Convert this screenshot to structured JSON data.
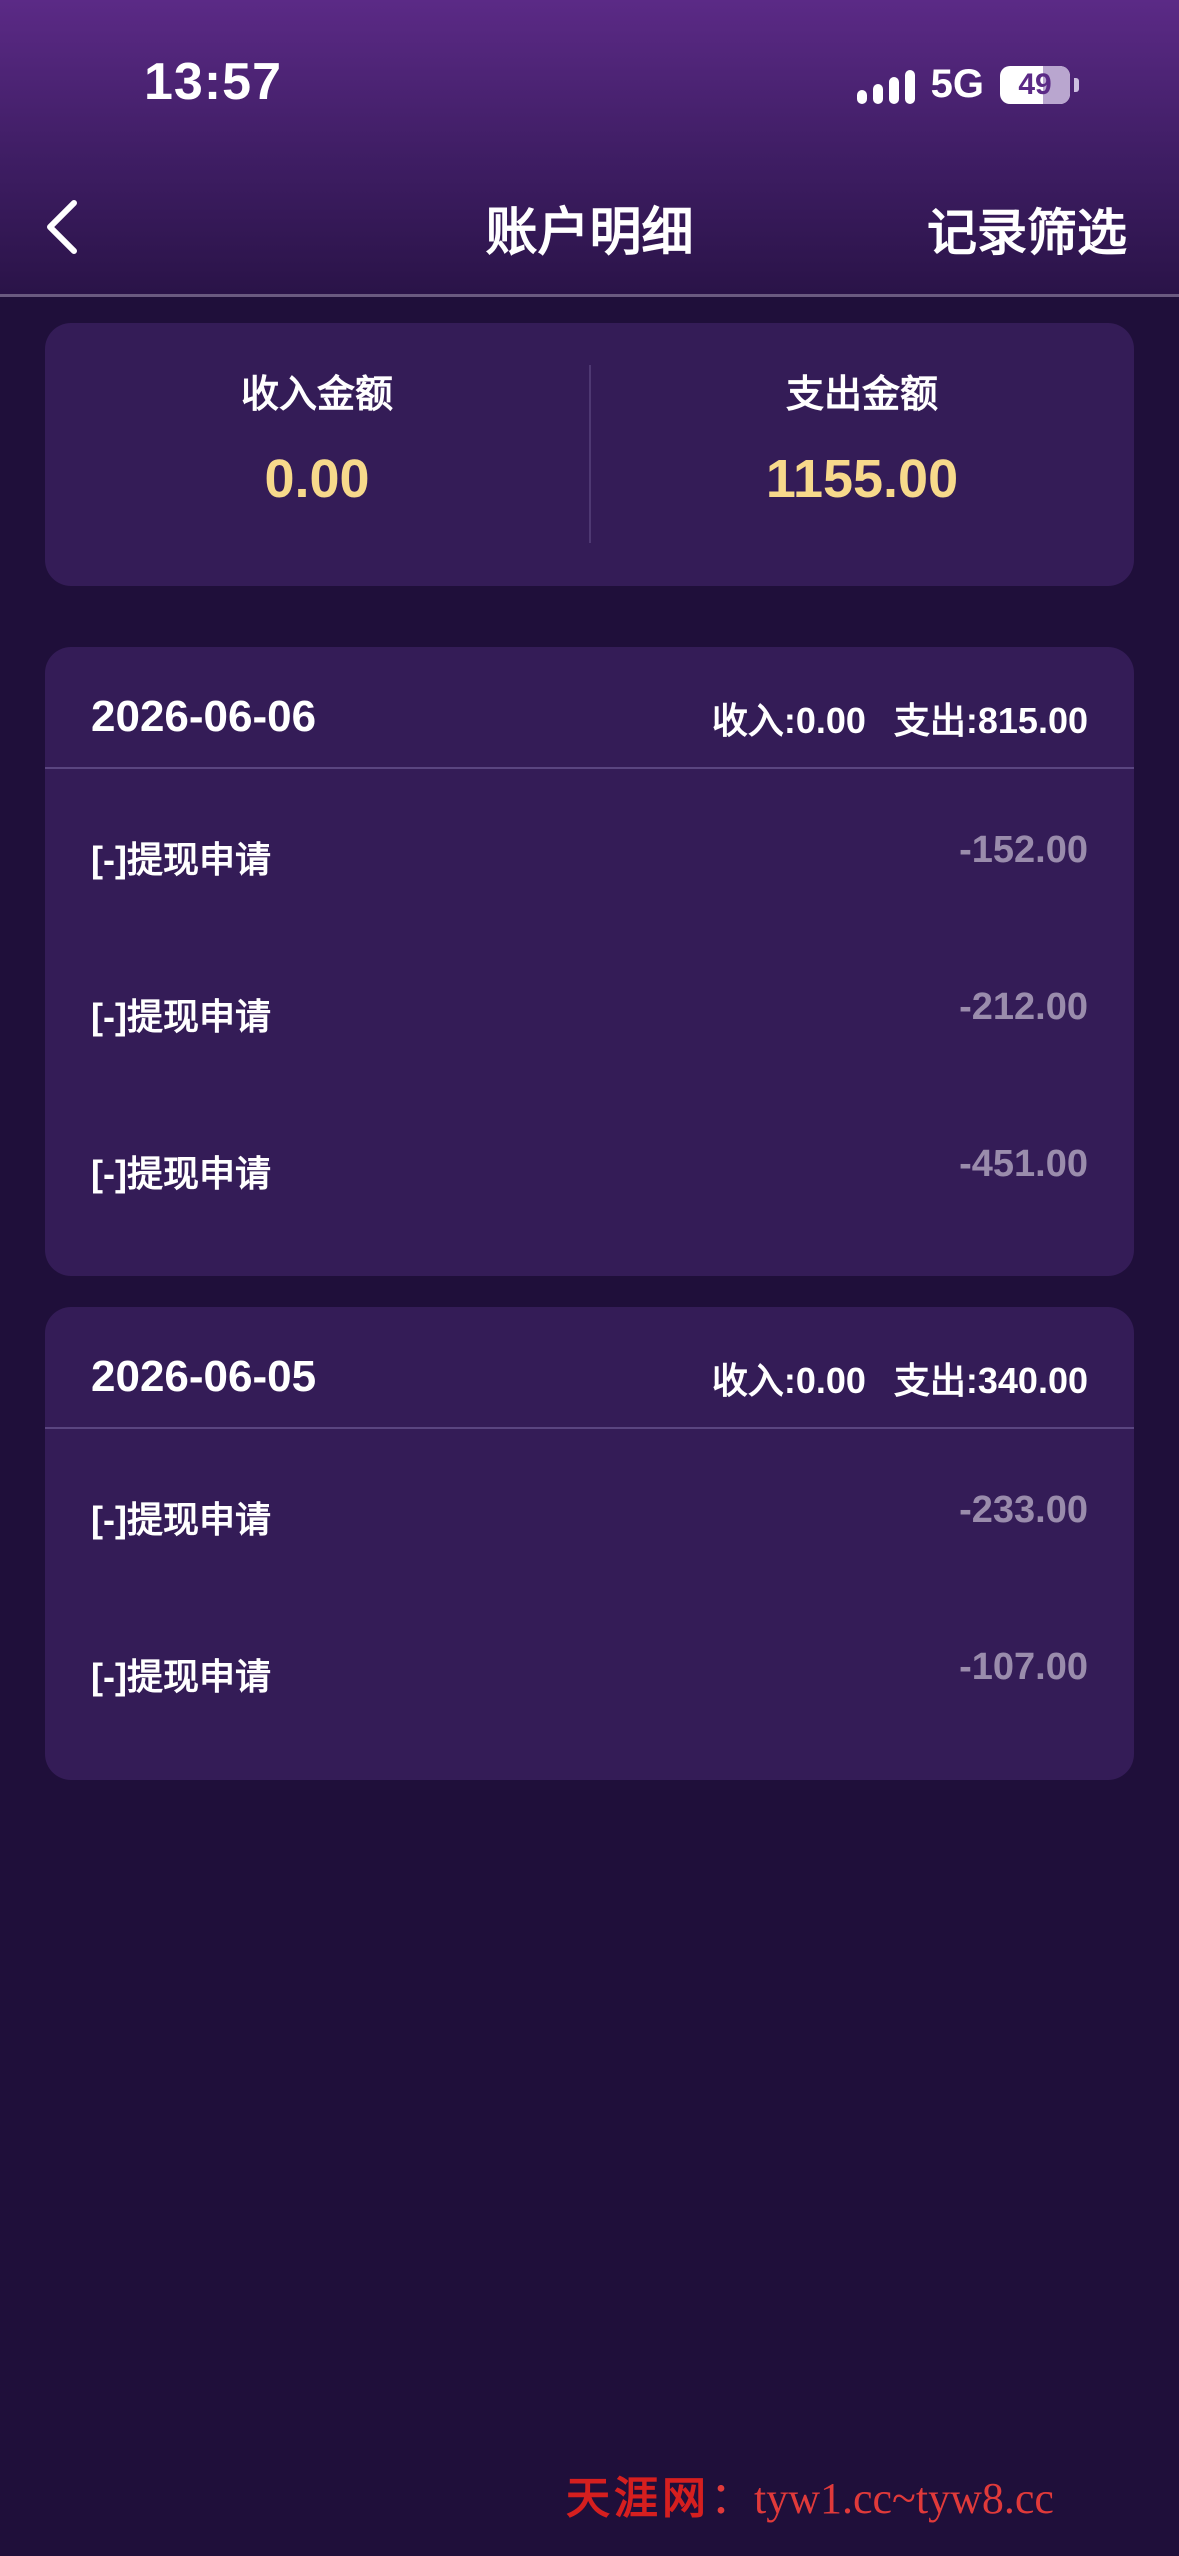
{
  "status_bar": {
    "time": "13:57",
    "network": "5G",
    "battery": "49"
  },
  "nav": {
    "back_icon": "chevron-left-icon",
    "title": "账户明细",
    "filter_label": "记录筛选"
  },
  "summary": {
    "income_label": "收入金额",
    "income_value": "0.00",
    "expense_label": "支出金额",
    "expense_value": "1155.00"
  },
  "groups": [
    {
      "date": "2026-06-06",
      "income": "收入:0.00",
      "expense": "支出:815.00",
      "entries": [
        {
          "label": "[-]提现申请",
          "amount": "-152.00"
        },
        {
          "label": "[-]提现申请",
          "amount": "-212.00"
        },
        {
          "label": "[-]提现申请",
          "amount": "-451.00"
        }
      ]
    },
    {
      "date": "2026-06-05",
      "income": "收入:0.00",
      "expense": "支出:340.00",
      "entries": [
        {
          "label": "[-]提现申请",
          "amount": "-233.00"
        },
        {
          "label": "[-]提现申请",
          "amount": "-107.00"
        }
      ]
    }
  ],
  "watermark": {
    "brand": "天涯网",
    "separator": "：",
    "url": "tyw1.cc~tyw8.cc"
  },
  "colors": {
    "background": "#1f0f3a",
    "card": "#341c57",
    "accent_amount": "#f7d98b",
    "muted_amount": "#9a8cac"
  }
}
